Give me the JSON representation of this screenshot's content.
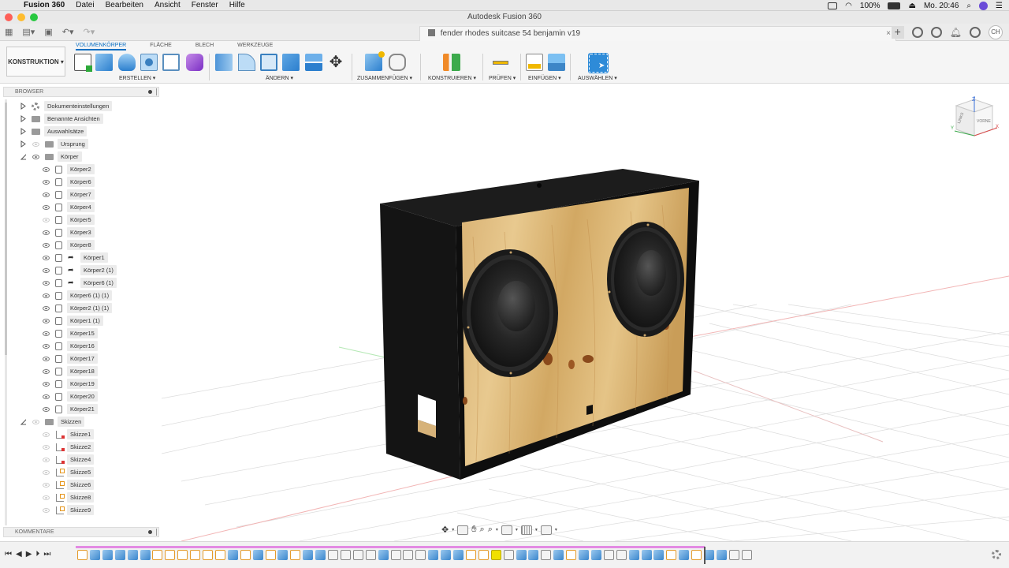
{
  "menubar": {
    "app": "Fusion 360",
    "items": [
      "Datei",
      "Bearbeiten",
      "Ansicht",
      "Fenster",
      "Hilfe"
    ],
    "battery": "100%",
    "clock": "Mo. 20:46"
  },
  "window": {
    "title": "Autodesk Fusion 360"
  },
  "document": {
    "tab_title": "fender rhodes suitcase 54 benjamin v19",
    "close": "×"
  },
  "user": {
    "initials": "CH"
  },
  "ribbon": {
    "workspace": "KONSTRUKTION ▾",
    "tabs": [
      "VOLUMENKÖRPER",
      "FLÄCHE",
      "BLECH",
      "WERKZEUGE"
    ],
    "groups": [
      "ERSTELLEN ▾",
      "ÄNDERN ▾",
      "ZUSAMMENFÜGEN ▾",
      "KONSTRUIEREN ▾",
      "PRÜFEN ▾",
      "EINFÜGEN ▾",
      "AUSWÄHLEN ▾"
    ]
  },
  "browser": {
    "title": "BROWSER",
    "folders": [
      "Dokumenteinstellungen",
      "Benannte Ansichten",
      "Auswahlsätze"
    ],
    "origin": "Ursprung",
    "bodies_folder": "Körper",
    "bodies": [
      "Körper2",
      "Körper6",
      "Körper7",
      "Körper4",
      "Körper5",
      "Körper3",
      "Körper8"
    ],
    "linked_bodies": [
      "Körper1",
      "Körper2 (1)",
      "Körper6 (1)"
    ],
    "bodies_more": [
      "Körper6 (1) (1)",
      "Körper2 (1) (1)",
      "Körper1 (1)",
      "Körper15",
      "Körper16",
      "Körper17",
      "Körper18",
      "Körper19",
      "Körper20",
      "Körper21"
    ],
    "sketches_folder": "Skizzen",
    "sketches": [
      "Skizze1",
      "Skizze2",
      "Skizze4",
      "Skizze5",
      "Skizze6",
      "Skizze8",
      "Skizze9"
    ]
  },
  "comments": {
    "title": "KOMMENTARE"
  },
  "viewcube": {
    "top": "Z",
    "left": "LINKS",
    "front": "VORNE",
    "x": "X",
    "y": "Y"
  },
  "colors": {
    "accent": "#0a6fc2",
    "timeline_track": "#e38be3",
    "selected_step": "#f2e600"
  }
}
